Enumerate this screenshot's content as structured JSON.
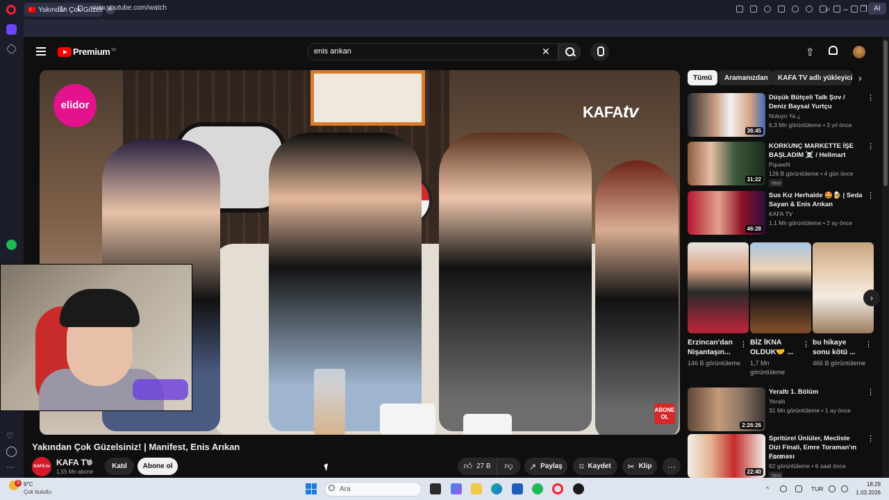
{
  "browser": {
    "tab_title": "Yakından Çok Güzelsin",
    "url": "www.youtube.com/watch",
    "ai_label": "AI"
  },
  "youtube": {
    "logo_text": "Premium",
    "logo_sup": "TR",
    "search_query": "enis arıkan"
  },
  "video": {
    "title": "Yakından Çok Güzelsiniz! | Manifest, Enis Arıkan",
    "overlay_brand": "elidor",
    "overlay_logo_a": "KAFA",
    "overlay_logo_b": "tv",
    "overlay_badge": "ABONE OL"
  },
  "channel": {
    "avatar_text": "KAFA tv",
    "name": "KAFA TV",
    "subscribers": "1,55 Mn abone",
    "join_label": "Katıl",
    "subscribe_label": "Abone ol"
  },
  "actions": {
    "likes": "27 B",
    "share": "Paylaş",
    "save": "Kaydet",
    "clip": "Klip"
  },
  "chips": [
    "Tümü",
    "Aramanızdan",
    "KAFA TV adlı yükleyiciden"
  ],
  "recommendations": [
    {
      "title": "Düşük Bütçeli Talk Şov / Deniz Baysal Yurtçu",
      "channel": "Noluyo Ya ¿",
      "meta": "6,3 Mn görüntüleme • 3 yıl önce",
      "duration": "36:45",
      "badge": ""
    },
    {
      "title": "KORKUNÇ MARKETTE İŞE BAŞLADIM ☠️ / Hellmart",
      "channel": "PqueeN",
      "meta": "126 B görüntüleme • 4 gün önce",
      "duration": "31:22",
      "badge": "Yeni"
    },
    {
      "title": "Sus Kız Herhalde 🤩🍺 | Seda Sayan & Enis Arıkan",
      "channel": "KAFA TV",
      "meta": "1,1 Mn görüntüleme • 2 ay önce",
      "duration": "46:28",
      "badge": ""
    }
  ],
  "shorts": [
    {
      "title": "Erzincan'dan Nişantaşın...",
      "views": "146 B görüntüleme"
    },
    {
      "title": "BİZ İKNA OLDUK🤝 ...",
      "views": "1,7 Mn görüntüleme"
    },
    {
      "title": "bu hikaye sonu kötü ...",
      "views": "466 B görüntüleme"
    }
  ],
  "recommendations_more": [
    {
      "title": "Yeraltı 1. Bölüm",
      "channel": "Yeraltı",
      "meta": "31 Mn görüntüleme • 1 ay önce",
      "duration": "2:26:26",
      "badge": ""
    },
    {
      "title": "Spritürel Ünlüler, Mecliste Dizi Finali, Emre Toraman'ın Forması",
      "channel": "Zann",
      "meta": "62 görüntüleme • 6 saat önce",
      "duration": "22:40",
      "badge": "Yeni"
    }
  ],
  "taskbar": {
    "weather_temp": "9°C",
    "weather_desc": "Çok bulutlu",
    "weather_alert": "3",
    "search_placeholder": "Ara",
    "lang": "TUR",
    "time": "18:29",
    "date": "1.03.2026"
  },
  "colors": {
    "yt_red": "#ff0000",
    "opera_red": "#ff1b2d",
    "kafa_red": "#d8182a",
    "elidor_pink": "#e5128e"
  }
}
